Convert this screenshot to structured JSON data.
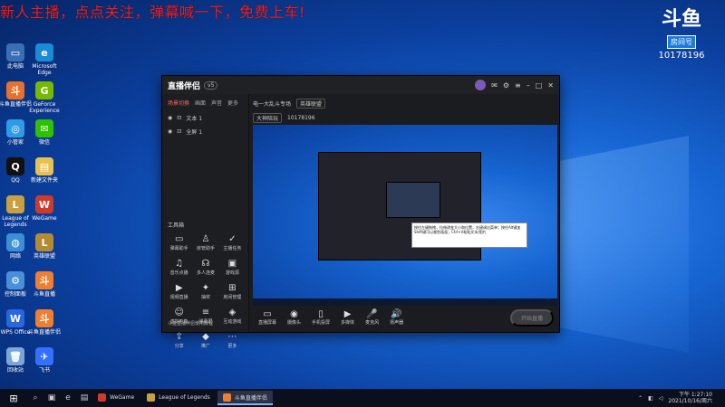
{
  "overlay_text": "新人主播，点点关注，弹幕喊一下，免费上车!",
  "room_badge": {
    "logo": "斗鱼",
    "tag": "房间号",
    "number": "10178196"
  },
  "desktop_icons": [
    {
      "label": "此电脑",
      "color": "#3b6fb5",
      "glyph": "▭"
    },
    {
      "label": "Microsoft Edge",
      "color": "#1a8bd6",
      "glyph": "e"
    },
    {
      "label": "斗鱼直播伴侣",
      "color": "#e8702a",
      "glyph": "斗"
    },
    {
      "label": "GeForce Experience",
      "color": "#76b900",
      "glyph": "G"
    },
    {
      "label": "小管家",
      "color": "#2e9be6",
      "glyph": "◎"
    },
    {
      "label": "微信",
      "color": "#2dc100",
      "glyph": "✉"
    },
    {
      "label": "QQ",
      "color": "#111",
      "glyph": "Q"
    },
    {
      "label": "新建文件夹",
      "color": "#e8c050",
      "glyph": "▤"
    },
    {
      "label": "League of Legends",
      "color": "#c8a040",
      "glyph": "L"
    },
    {
      "label": "WeGame",
      "color": "#d03a2a",
      "glyph": "W"
    },
    {
      "label": "网络",
      "color": "#3b8fd5",
      "glyph": "◍"
    },
    {
      "label": "英雄联盟",
      "color": "#b48a32",
      "glyph": "L"
    },
    {
      "label": "控制面板",
      "color": "#4a90d9",
      "glyph": "⚙"
    },
    {
      "label": "斗鱼直播",
      "color": "#f07e2e",
      "glyph": "斗"
    },
    {
      "label": "WPS Office",
      "color": "#2867e0",
      "glyph": "W"
    },
    {
      "label": "斗鱼直播伴侣",
      "color": "#f07e2e",
      "glyph": "斗"
    },
    {
      "label": "回收站",
      "color": "#7aa7d8",
      "glyph": "🗑"
    },
    {
      "label": "飞书",
      "color": "#3370ff",
      "glyph": "✈"
    }
  ],
  "app": {
    "name": "直播伴侣",
    "version": "v5",
    "scene_tabs": [
      "场景切换",
      "画面",
      "声音",
      "更多"
    ],
    "scenes": [
      "文本 1",
      "全屏 1"
    ],
    "tools_title": "工具箱",
    "tools": [
      {
        "label": "弹幕助手",
        "icon": "▭"
      },
      {
        "label": "房管助手",
        "icon": "♙"
      },
      {
        "label": "主播任务",
        "icon": "✓"
      },
      {
        "label": "音乐点播",
        "icon": "♫"
      },
      {
        "label": "多人连麦",
        "icon": "☊"
      },
      {
        "label": "游戏源",
        "icon": "▣"
      },
      {
        "label": "视频直播",
        "icon": "▶"
      },
      {
        "label": "抽奖",
        "icon": "✦"
      },
      {
        "label": "房间管理",
        "icon": "⊞"
      },
      {
        "label": "虚拟形象",
        "icon": "☺"
      },
      {
        "label": "弹幕屏",
        "icon": "≡"
      },
      {
        "label": "互动游戏",
        "icon": "◈"
      },
      {
        "label": "分享",
        "icon": "⇪"
      },
      {
        "label": "推广",
        "icon": "◆"
      },
      {
        "label": "更多",
        "icon": "⋯"
      }
    ],
    "bottom_hint": "斗鱼直播伴侣使用教程",
    "room_title": "电一大乱斗专场",
    "room_category": "英雄联盟",
    "room_tag": "大神陪玩",
    "room_id": "10178196",
    "controls": [
      {
        "label": "直播屏幕",
        "icon": "▭"
      },
      {
        "label": "摄像头",
        "icon": "◉"
      },
      {
        "label": "手机投屏",
        "icon": "▯"
      },
      {
        "label": "多媒体",
        "icon": "▶"
      },
      {
        "label": "麦克风",
        "icon": "🎤"
      },
      {
        "label": "扬声器",
        "icon": "🔊"
      }
    ],
    "start_label": "开始直播",
    "tooltip": "按住左键拖拽，拉伸改变大小和位置，右键调出菜单；按住Alt键加Shift键可以裁剪画面；Ctrl+V粘贴文本/图片"
  },
  "taskbar": {
    "apps": [
      {
        "label": "WeGame",
        "color": "#d03a2a",
        "active": false
      },
      {
        "label": "League of Legends",
        "color": "#c8a040",
        "active": false
      },
      {
        "label": "斗鱼直播伴侣",
        "color": "#f07e2e",
        "active": true
      }
    ],
    "time": "下午 1:27:10",
    "date": "2021/10/16/周六"
  }
}
